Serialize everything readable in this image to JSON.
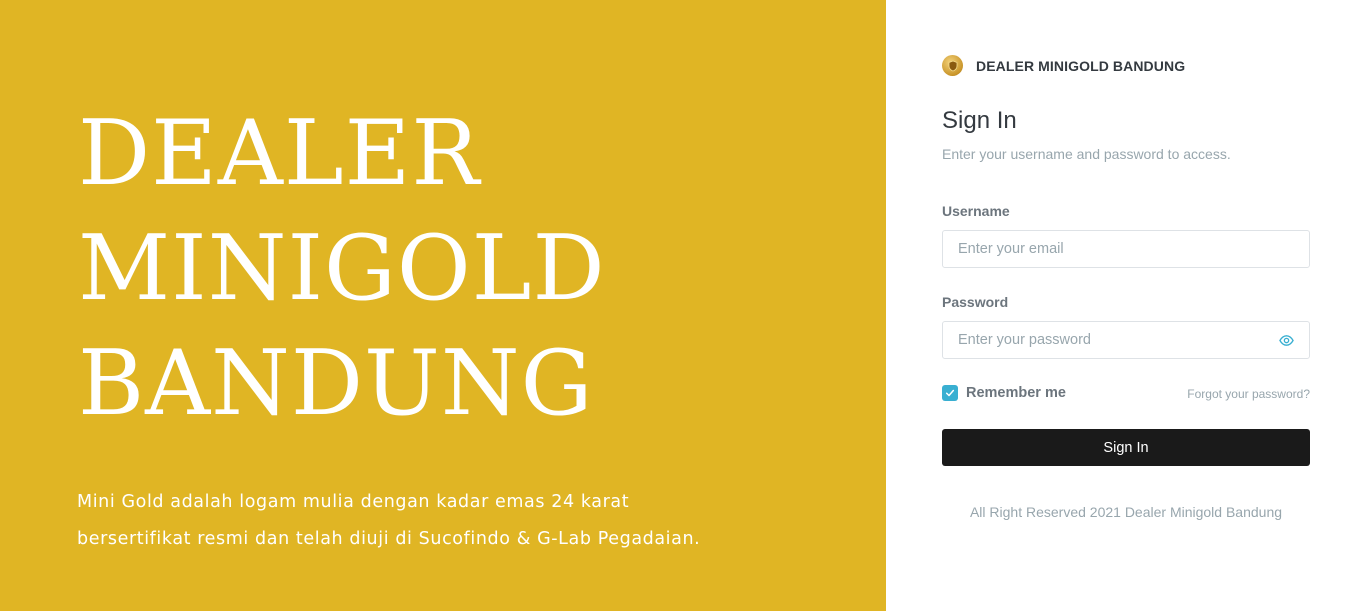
{
  "hero": {
    "title_lines": [
      "DEALER",
      "MINIGOLD",
      "BANDUNG"
    ],
    "description_lines": [
      "Mini Gold adalah logam mulia dengan kadar emas 24 karat",
      "bersertifikat resmi dan telah diuji di Sucofindo & G-Lab Pegadaian."
    ],
    "background_color": "#e0b524"
  },
  "brand": {
    "name": "DEALER MINIGOLD BANDUNG",
    "logo_icon": "gold-coin-logo"
  },
  "form": {
    "title": "Sign In",
    "subtitle": "Enter your username and password to access.",
    "username_label": "Username",
    "username_placeholder": "Enter your email",
    "username_value": "",
    "password_label": "Password",
    "password_placeholder": "Enter your password",
    "password_value": "",
    "show_password_icon": "eye-icon",
    "remember_label": "Remember me",
    "remember_checked": true,
    "forgot_label": "Forgot your password?",
    "submit_label": "Sign In"
  },
  "footer": {
    "text": "All Right Reserved 2021 Dealer Minigold Bandung"
  },
  "colors": {
    "accent": "#39afd1",
    "button": "#1a1a1a",
    "muted": "#98a6ad"
  }
}
